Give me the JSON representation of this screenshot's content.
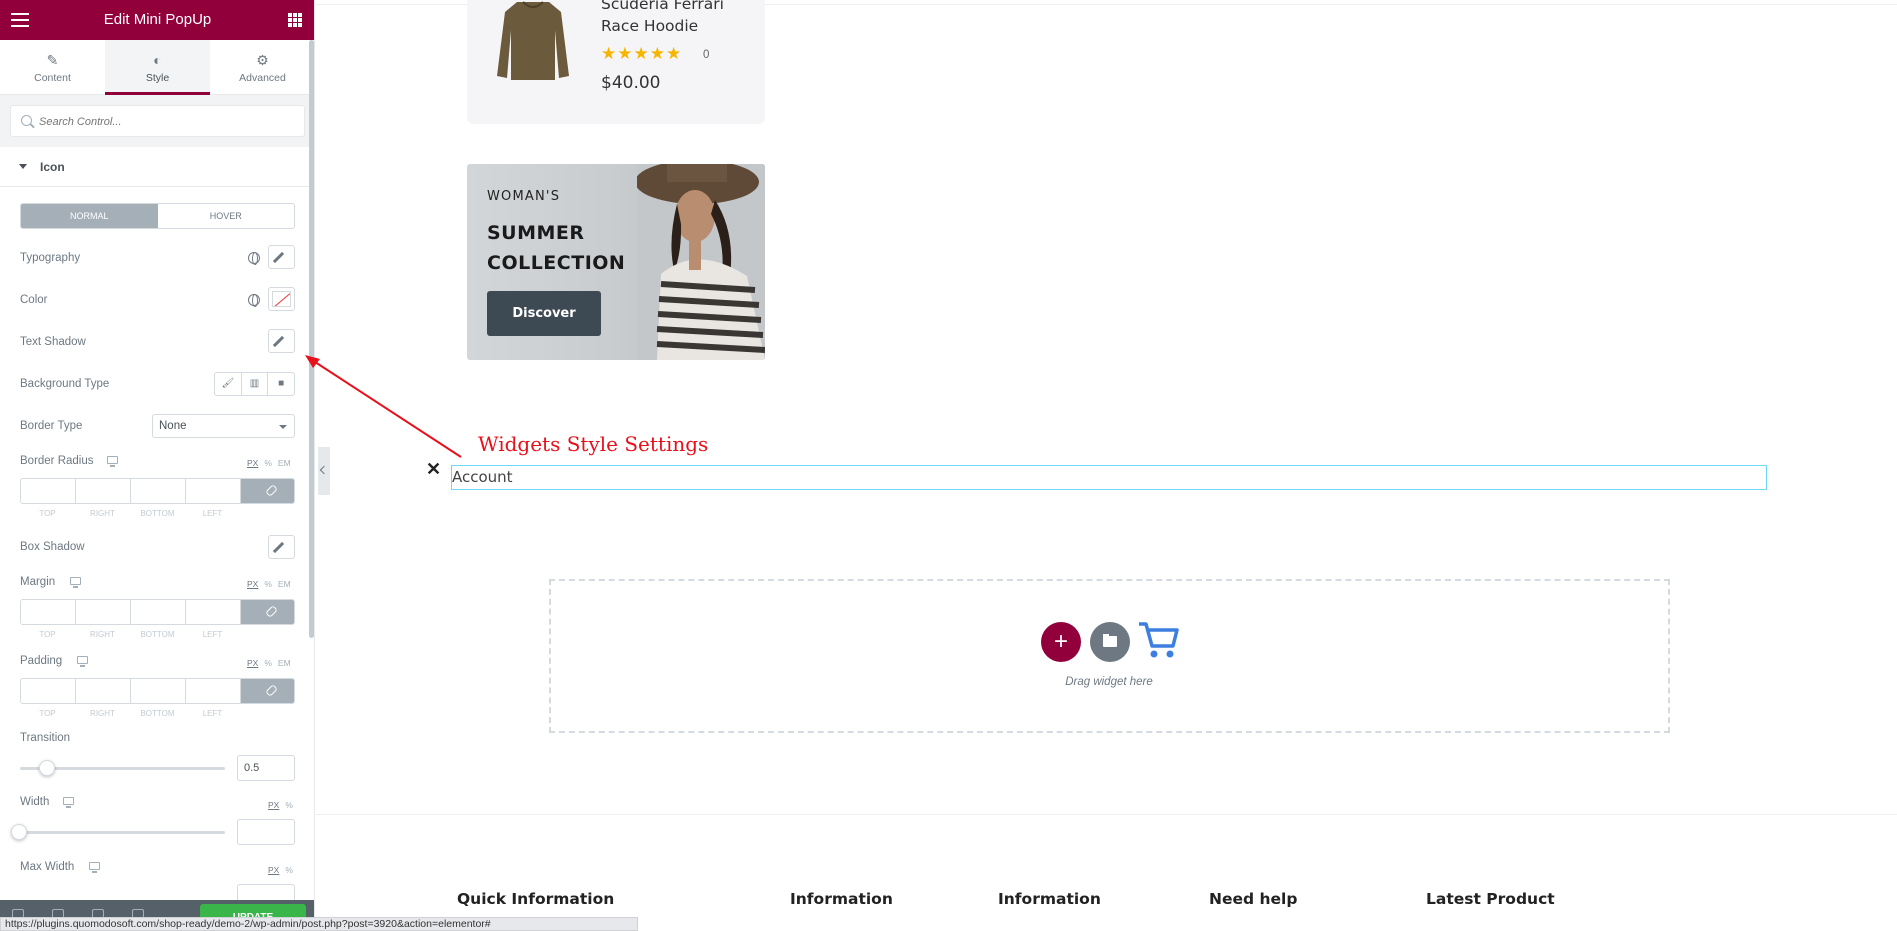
{
  "editor": {
    "title": "Edit Mini PopUp",
    "tabs": [
      {
        "label": "Content",
        "icon": "pencil-icon"
      },
      {
        "label": "Style",
        "icon": "half-circle-icon"
      },
      {
        "label": "Advanced",
        "icon": "gear-icon"
      }
    ],
    "active_tab": "Style",
    "search_placeholder": "Search Control...",
    "section": "Icon",
    "state_toggle": {
      "normal": "NORMAL",
      "hover": "HOVER",
      "active": "NORMAL"
    },
    "controls": {
      "typography": "Typography",
      "color": "Color",
      "text_shadow": "Text Shadow",
      "background_type": "Background Type",
      "border_type": "Border Type",
      "border_type_value": "None",
      "border_radius": "Border Radius",
      "box_shadow": "Box Shadow",
      "margin": "Margin",
      "padding": "Padding",
      "transition": "Transition",
      "transition_value": "0.5",
      "width": "Width",
      "max_width": "Max Width"
    },
    "units": {
      "px": "PX",
      "pct": "%",
      "em": "EM"
    },
    "dim_labels": {
      "top": "TOP",
      "right": "RIGHT",
      "bottom": "BOTTOM",
      "left": "LEFT"
    },
    "update_button": "UPDATE",
    "status_url": "https://plugins.quomodosoft.com/shop-ready/demo-2/wp-admin/post.php?post=3920&action=elementor#"
  },
  "canvas": {
    "product": {
      "name": "Scuderia Ferrari Race Hoodie",
      "rating_stars": 5,
      "rating_count": "0",
      "price": "$40.00"
    },
    "banner": {
      "subtitle": "WOMAN'S",
      "title": "SUMMER COLLECTION",
      "button": "Discover"
    },
    "annotation": "Widgets Style Settings",
    "account_label": "Account",
    "dropzone_text": "Drag widget here",
    "footer_columns": [
      "Quick Information",
      "Information",
      "Information",
      "Need help",
      "Latest Product"
    ]
  },
  "colors": {
    "brand": "#92003b",
    "annotation_red": "#e8101b",
    "selection_cyan": "#71d7f7",
    "star": "#f7b500",
    "update_green": "#39b54a"
  }
}
